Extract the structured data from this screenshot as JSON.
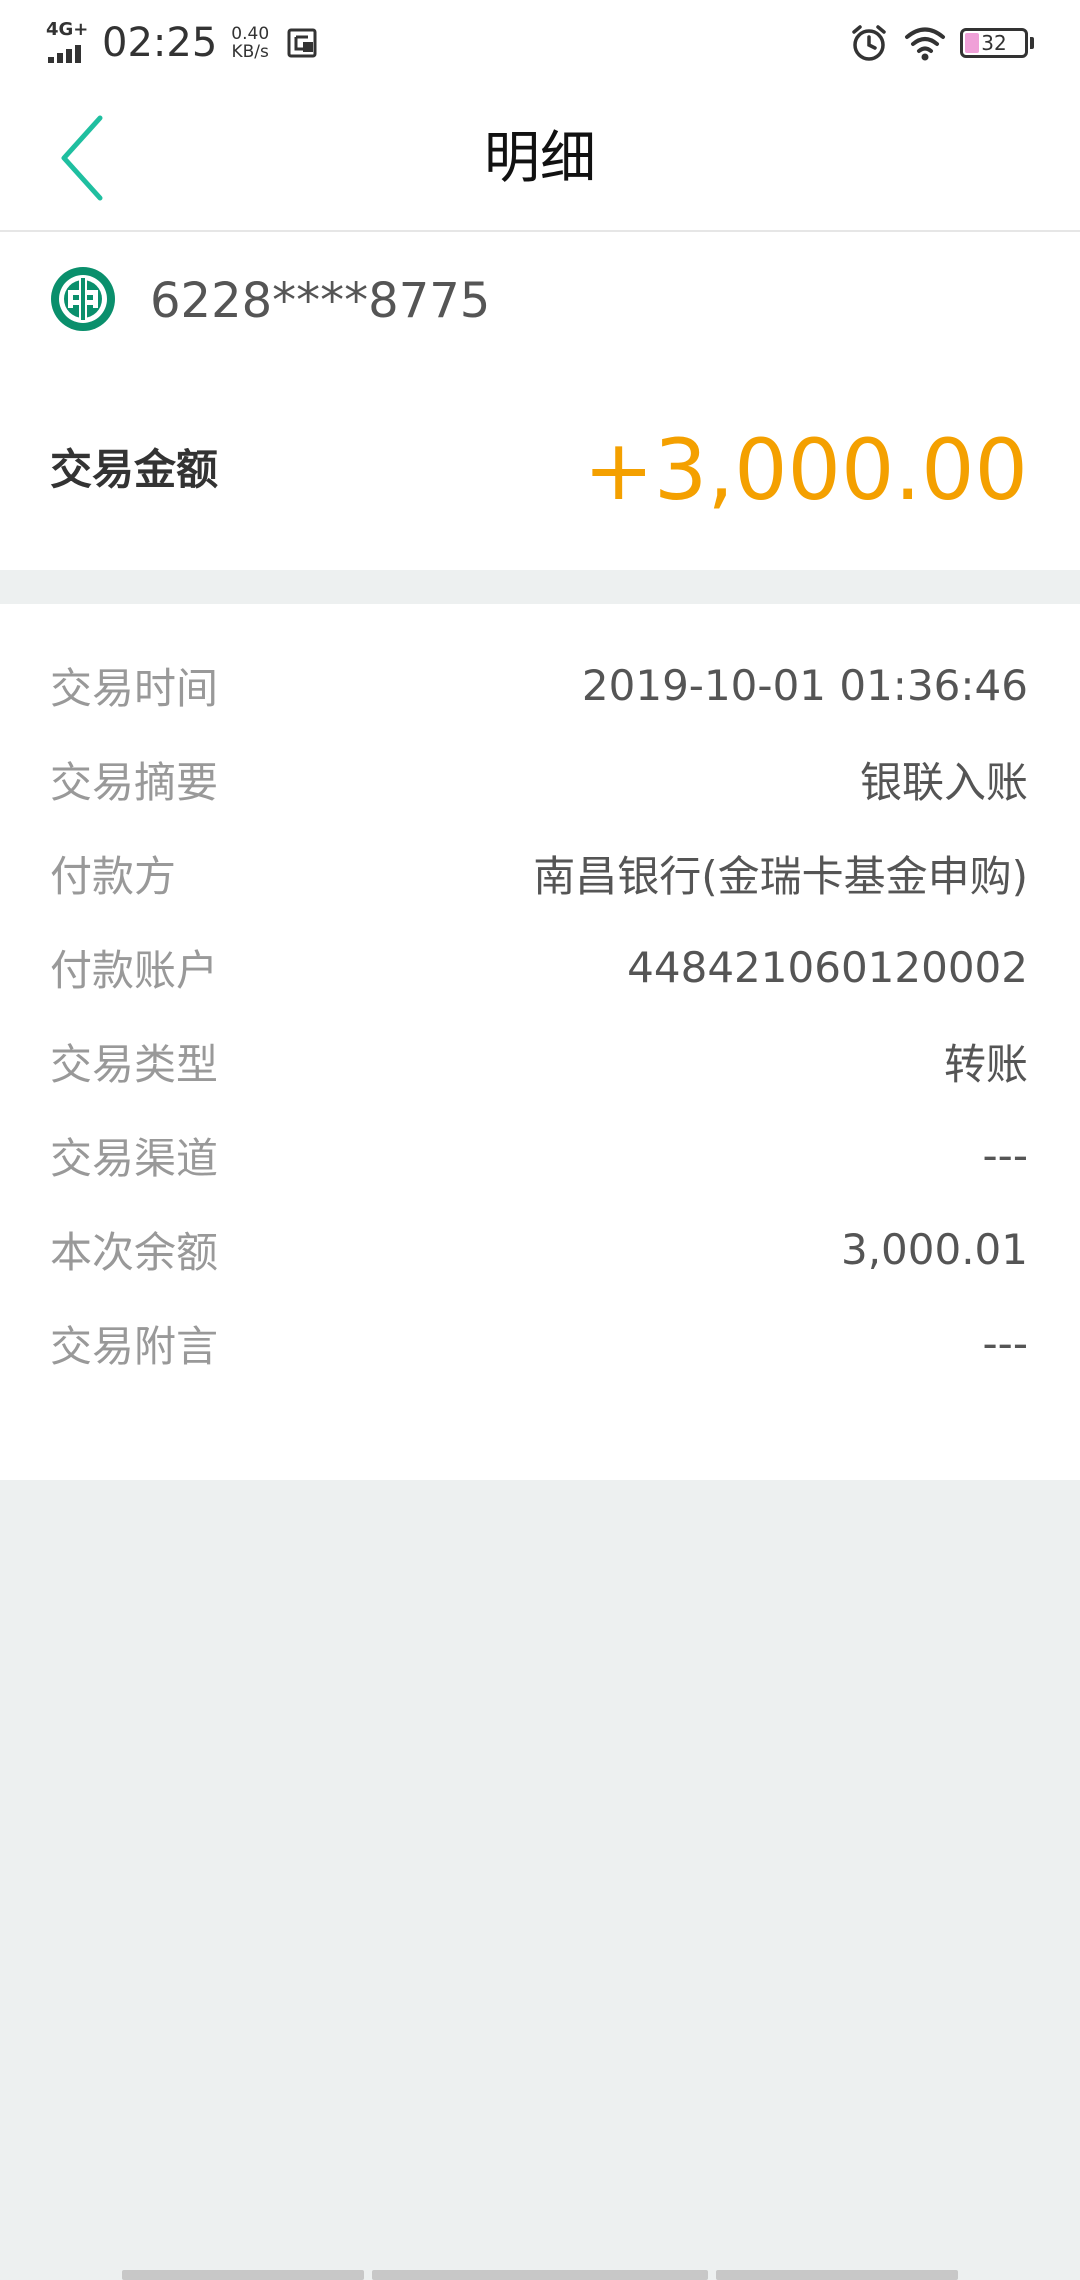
{
  "status_bar": {
    "network": "4G+",
    "time": "02:25",
    "speed_value": "0.40",
    "speed_unit": "KB/s",
    "battery_level": "32",
    "icons": [
      "signal-icon",
      "screenshot-icon",
      "alarm-icon",
      "wifi-icon",
      "battery-icon"
    ]
  },
  "header": {
    "title": "明细",
    "back_icon": "chevron-left-icon",
    "accent_color": "#1fbfa0"
  },
  "summary": {
    "bank_logo_icon": "abc-bank-logo-icon",
    "card_number": "6228****8775",
    "amount_label": "交易金额",
    "amount_value": "+3,000.00",
    "amount_color": "#f4a000"
  },
  "details": [
    {
      "label": "交易时间",
      "value": "2019-10-01 01:36:46"
    },
    {
      "label": "交易摘要",
      "value": "银联入账"
    },
    {
      "label": "付款方",
      "value": "南昌银行(金瑞卡基金申购)"
    },
    {
      "label": "付款账户",
      "value": "448421060120002"
    },
    {
      "label": "交易类型",
      "value": "转账"
    },
    {
      "label": "交易渠道",
      "value": "---"
    },
    {
      "label": "本次余额",
      "value": "3,000.01"
    },
    {
      "label": "交易附言",
      "value": "---"
    }
  ]
}
